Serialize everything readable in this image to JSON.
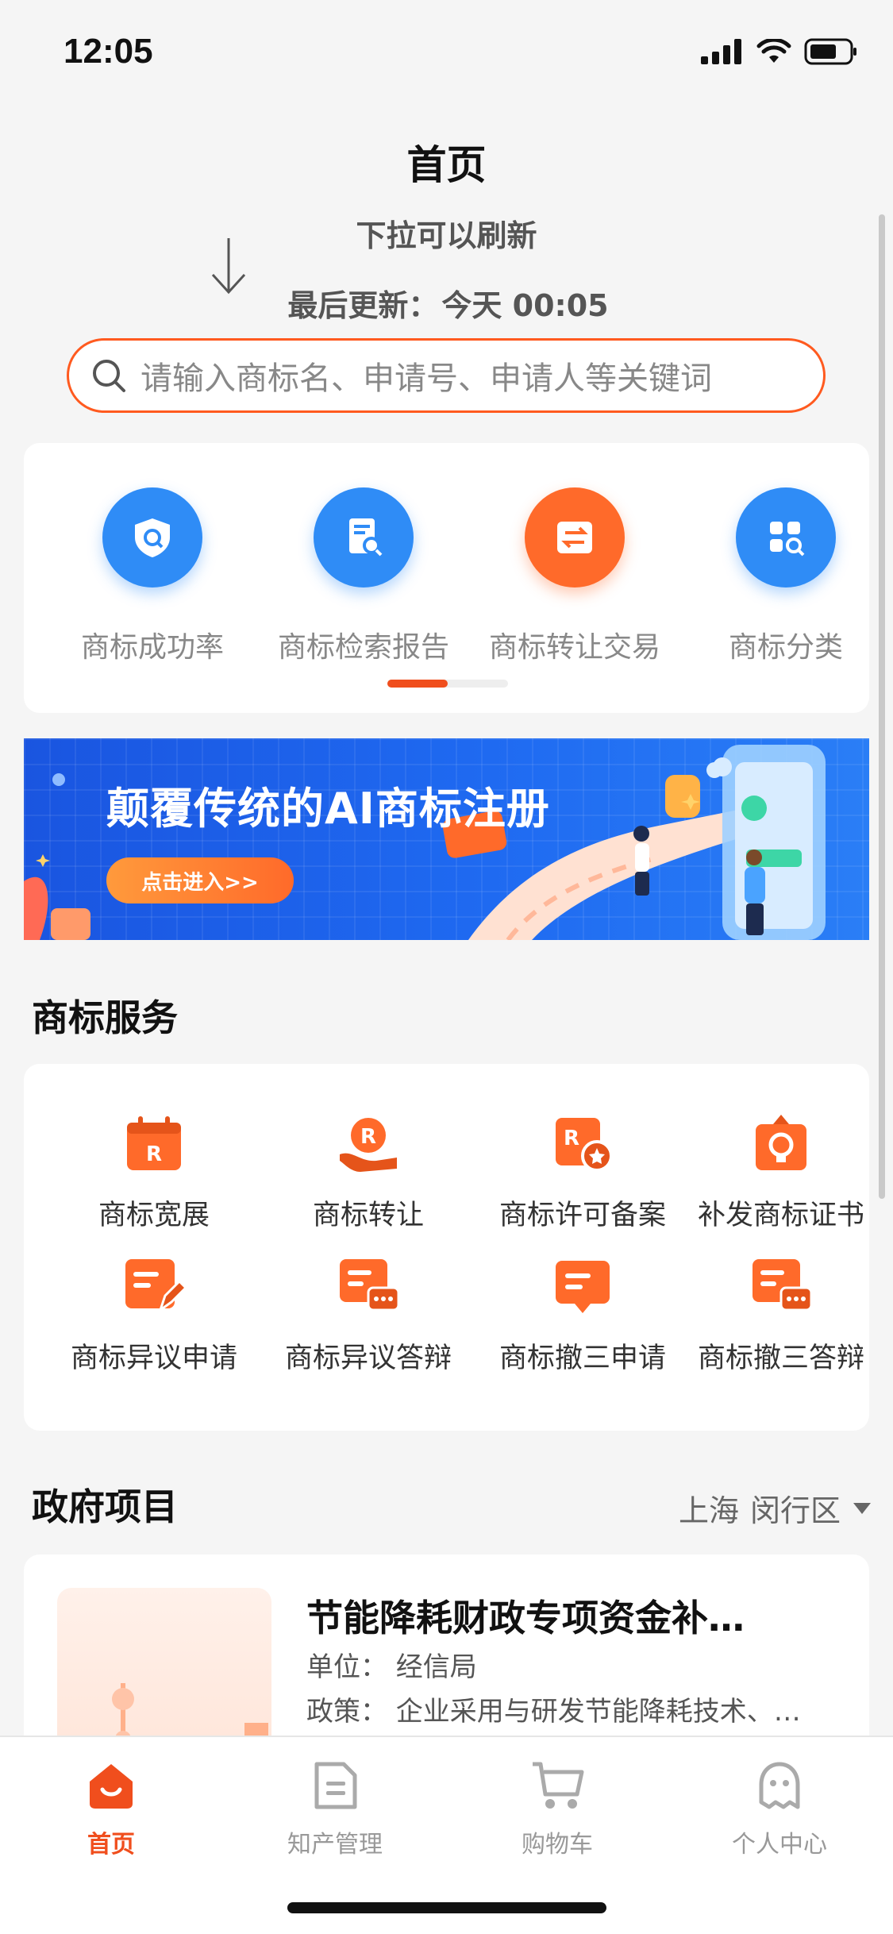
{
  "status_bar": {
    "time": "12:05"
  },
  "nav": {
    "title": "首页"
  },
  "refresh": {
    "pull_text": "下拉可以刷新",
    "last_update_label": "最后更新：",
    "last_update_value": "今天 00:05"
  },
  "search": {
    "placeholder": "请输入商标名、申请号、申请人等关键词"
  },
  "quick_entries": [
    {
      "label": "商标成功率",
      "icon": "shield-search-icon",
      "color": "#2f8cf6"
    },
    {
      "label": "商标检索报告",
      "icon": "report-search-icon",
      "color": "#2f8cf6"
    },
    {
      "label": "商标转让交易",
      "icon": "transfer-icon",
      "color": "#ff6a2a"
    },
    {
      "label": "商标分类",
      "icon": "category-icon",
      "color": "#2f8cf6"
    }
  ],
  "banner": {
    "title": "颠覆传统的AI商标注册",
    "button_label": "点击进入>>"
  },
  "services": {
    "title": "商标服务",
    "items": [
      {
        "label": "商标宽展",
        "icon": "calendar-r-icon"
      },
      {
        "label": "商标转让",
        "icon": "hand-r-icon"
      },
      {
        "label": "商标许可备案",
        "icon": "license-r-icon"
      },
      {
        "label": "补发商标证书",
        "icon": "certificate-icon"
      },
      {
        "label": "商标异议申请",
        "icon": "edit-doc-icon"
      },
      {
        "label": "商标异议答辩",
        "icon": "chat-doc-icon"
      },
      {
        "label": "商标撤三申请",
        "icon": "message-icon"
      },
      {
        "label": "商标撤三答辩",
        "icon": "chat-doc-icon"
      }
    ]
  },
  "government": {
    "title": "政府项目",
    "city": "上海",
    "district": "闵行区",
    "item": {
      "title": "节能降耗财政专项资金补…",
      "unit": "单位：  经信局",
      "policy": "政策：  企业采用与研发节能降耗技术、…"
    }
  },
  "tabbar": [
    {
      "label": "首页",
      "icon": "home-icon",
      "active": true
    },
    {
      "label": "知产管理",
      "icon": "document-icon",
      "active": false
    },
    {
      "label": "购物车",
      "icon": "cart-icon",
      "active": false
    },
    {
      "label": "个人中心",
      "icon": "user-icon",
      "active": false
    }
  ],
  "colors": {
    "accent": "#f04e1d",
    "blue": "#2f8cf6"
  }
}
